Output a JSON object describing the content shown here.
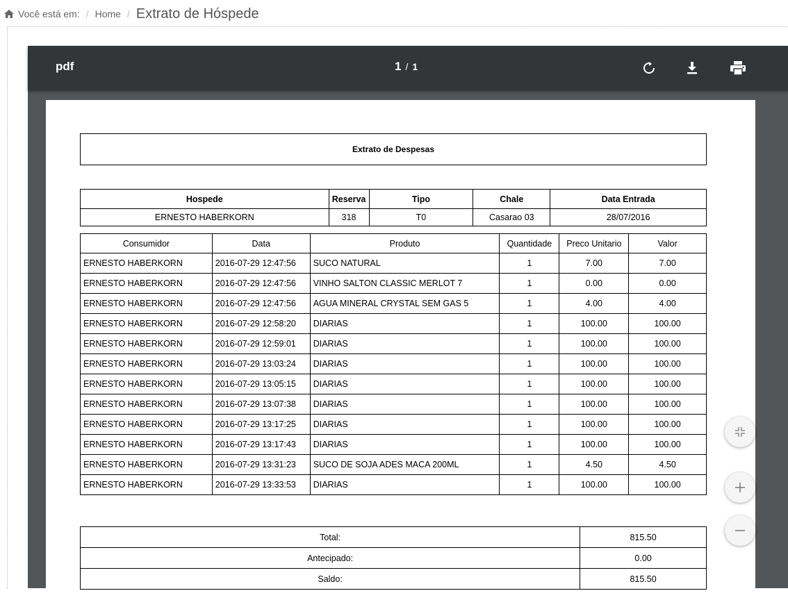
{
  "breadcrumb": {
    "prefix": "Você está em:",
    "home": "Home",
    "current": "Extrato de Hóspede"
  },
  "viewer": {
    "title": "pdf",
    "page_current": "1",
    "page_separator": "/",
    "page_total": "1"
  },
  "document": {
    "title": "Extrato de Despesas",
    "header": {
      "columns": [
        "Hospede",
        "Reserva",
        "Tipo",
        "Chale",
        "Data Entrada"
      ],
      "values": [
        "ERNESTO HABERKORN",
        "318",
        "T0",
        "Casarao 03",
        "28/07/2016"
      ]
    },
    "items_columns": [
      "Consumidor",
      "Data",
      "Produto",
      "Quantidade",
      "Preco Unitario",
      "Valor"
    ],
    "items": [
      [
        "ERNESTO HABERKORN",
        "2016-07-29 12:47:56",
        "SUCO NATURAL",
        "1",
        "7.00",
        "7.00"
      ],
      [
        "ERNESTO HABERKORN",
        "2016-07-29 12:47:56",
        "VINHO  SALTON CLASSIC MERLOT 7",
        "1",
        "0.00",
        "0.00"
      ],
      [
        "ERNESTO HABERKORN",
        "2016-07-29 12:47:56",
        "AGUA MINERAL CRYSTAL SEM GAS 5",
        "1",
        "4.00",
        "4.00"
      ],
      [
        "ERNESTO HABERKORN",
        "2016-07-29 12:58:20",
        "DIARIAS",
        "1",
        "100.00",
        "100.00"
      ],
      [
        "ERNESTO HABERKORN",
        "2016-07-29 12:59:01",
        "DIARIAS",
        "1",
        "100.00",
        "100.00"
      ],
      [
        "ERNESTO HABERKORN",
        "2016-07-29 13:03:24",
        "DIARIAS",
        "1",
        "100.00",
        "100.00"
      ],
      [
        "ERNESTO HABERKORN",
        "2016-07-29 13:05:15",
        "DIARIAS",
        "1",
        "100.00",
        "100.00"
      ],
      [
        "ERNESTO HABERKORN",
        "2016-07-29 13:07:38",
        "DIARIAS",
        "1",
        "100.00",
        "100.00"
      ],
      [
        "ERNESTO HABERKORN",
        "2016-07-29 13:17:25",
        "DIARIAS",
        "1",
        "100.00",
        "100.00"
      ],
      [
        "ERNESTO HABERKORN",
        "2016-07-29 13:17:43",
        "DIARIAS",
        "1",
        "100.00",
        "100.00"
      ],
      [
        "ERNESTO HABERKORN",
        "2016-07-29 13:31:23",
        "SUCO DE SOJA ADES MACA 200ML",
        "1",
        "4.50",
        "4.50"
      ],
      [
        "ERNESTO HABERKORN",
        "2016-07-29 13:33:53",
        "DIARIAS",
        "1",
        "100.00",
        "100.00"
      ]
    ],
    "totals": [
      {
        "label": "Total:",
        "value": "815.50"
      },
      {
        "label": "Antecipado:",
        "value": "0.00"
      },
      {
        "label": "Saldo:",
        "value": "815.50"
      }
    ]
  },
  "icons": {
    "home": "home-icon",
    "rotate": "rotate-icon",
    "download": "download-icon",
    "print": "print-icon",
    "fit": "fit-page-icon",
    "zoom_in": "plus-icon",
    "zoom_out": "minus-icon"
  },
  "colors": {
    "toolbar": "#323639",
    "viewer_bg": "#525659",
    "page": "#ffffff"
  }
}
